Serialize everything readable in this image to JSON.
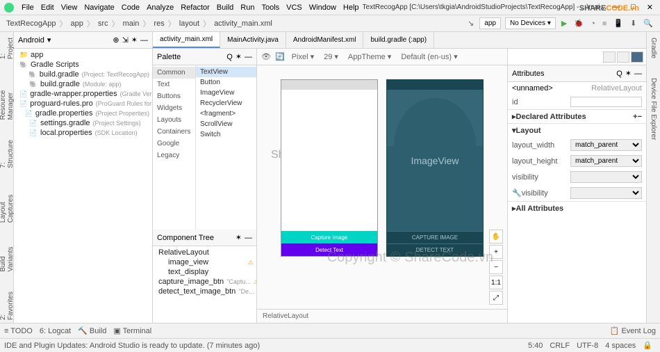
{
  "window": {
    "title": "TextRecogApp [C:\\Users\\tkgia\\AndroidStudioProjects\\TextRecogApp] - ...\\main\\res\\layout\\activity_main.xml [app]"
  },
  "menu": [
    "File",
    "Edit",
    "View",
    "Navigate",
    "Code",
    "Analyze",
    "Refactor",
    "Build",
    "Run",
    "Tools",
    "VCS",
    "Window",
    "Help"
  ],
  "breadcrumb": [
    "TextRecogApp",
    "app",
    "src",
    "main",
    "res",
    "layout",
    "activity_main.xml"
  ],
  "toolbar": {
    "module": "app",
    "device": "No Devices ▾"
  },
  "project": {
    "mode": "Android",
    "nodes": [
      {
        "indent": 0,
        "icon": "folder-icon",
        "name": "app",
        "desc": ""
      },
      {
        "indent": 0,
        "icon": "gradle-icon",
        "name": "Gradle Scripts",
        "desc": ""
      },
      {
        "indent": 1,
        "icon": "gradle-icon",
        "name": "build.gradle",
        "desc": "(Project: TextRecogApp)"
      },
      {
        "indent": 1,
        "icon": "gradle-icon",
        "name": "build.gradle",
        "desc": "(Module: app)"
      },
      {
        "indent": 1,
        "icon": "file-icon",
        "name": "gradle-wrapper.properties",
        "desc": "(Gradle Version)"
      },
      {
        "indent": 1,
        "icon": "file-icon",
        "name": "proguard-rules.pro",
        "desc": "(ProGuard Rules for app)"
      },
      {
        "indent": 1,
        "icon": "file-icon",
        "name": "gradle.properties",
        "desc": "(Project Properties)"
      },
      {
        "indent": 1,
        "icon": "file-icon",
        "name": "settings.gradle",
        "desc": "(Project Settings)"
      },
      {
        "indent": 1,
        "icon": "file-icon",
        "name": "local.properties",
        "desc": "(SDK Location)"
      }
    ]
  },
  "tabs": [
    {
      "name": "activity_main.xml",
      "active": true
    },
    {
      "name": "MainActivity.java",
      "active": false
    },
    {
      "name": "AndroidManifest.xml",
      "active": false
    },
    {
      "name": "build.gradle (:app)",
      "active": false
    }
  ],
  "palette": {
    "title": "Palette",
    "categories": [
      "Common",
      "Text",
      "Buttons",
      "Widgets",
      "Layouts",
      "Containers",
      "Google",
      "Legacy"
    ],
    "items": [
      "TextView",
      "Button",
      "ImageView",
      "RecyclerView",
      "<fragment>",
      "ScrollView",
      "Switch"
    ]
  },
  "componentTree": {
    "title": "Component Tree",
    "nodes": [
      {
        "indent": 0,
        "name": "RelativeLayout",
        "warn": false
      },
      {
        "indent": 1,
        "name": "image_view",
        "warn": true
      },
      {
        "indent": 1,
        "name": "text_display",
        "warn": false
      },
      {
        "indent": 1,
        "name": "capture_image_btn",
        "desc": "\"Captu...",
        "warn": true
      },
      {
        "indent": 1,
        "name": "detect_text_image_btn",
        "desc": "\"De...",
        "warn": true
      }
    ]
  },
  "designToolbar": {
    "device": "Pixel ▾",
    "api": "29 ▾",
    "theme": "AppTheme ▾",
    "locale": "Default (en-us) ▾"
  },
  "phone": {
    "imageViewLabel": "ImageView",
    "captureLabel": "Capture Image",
    "detectLabel": "Detect Text",
    "bpCaptureLabel": "CAPTURE IMAGE",
    "bpDetectLabel": "DETECT TEXT"
  },
  "designStatus": "RelativeLayout",
  "attr": {
    "title": "Attributes",
    "unnamed": "<unnamed>",
    "rootType": "RelativeLayout",
    "idLabel": "id",
    "declared": "Declared Attributes",
    "layoutSection": "Layout",
    "layout_width_l": "layout_width",
    "layout_width_v": "match_parent",
    "layout_height_l": "layout_height",
    "layout_height_v": "match_parent",
    "visibility_l": "visibility",
    "tools_visibility_l": "visibility",
    "allAttr": "All Attributes"
  },
  "leftGutter": [
    "1: Project",
    "7: Structure",
    "Layout Captures",
    "Build Variants",
    "2: Favorites"
  ],
  "rightGutter": [
    "Gradle",
    "Device File Explorer"
  ],
  "leftGutter2": "Resource Manager",
  "bottomTools": [
    "TODO",
    "6: Logcat",
    "Build",
    "Terminal"
  ],
  "eventLog": "Event Log",
  "statusMsg": "IDE and Plugin Updates: Android Studio is ready to update. (7 minutes ago)",
  "statusRight": {
    "pos": "5:40",
    "eol": "CRLF",
    "enc": "UTF-8",
    "indent": "4 spaces"
  },
  "watermark1": "ShareCode.vn",
  "watermark2": "Copyright © ShareCode.vn",
  "brandLogo": {
    "a": "SHARE",
    "b": "CODE.vn"
  }
}
